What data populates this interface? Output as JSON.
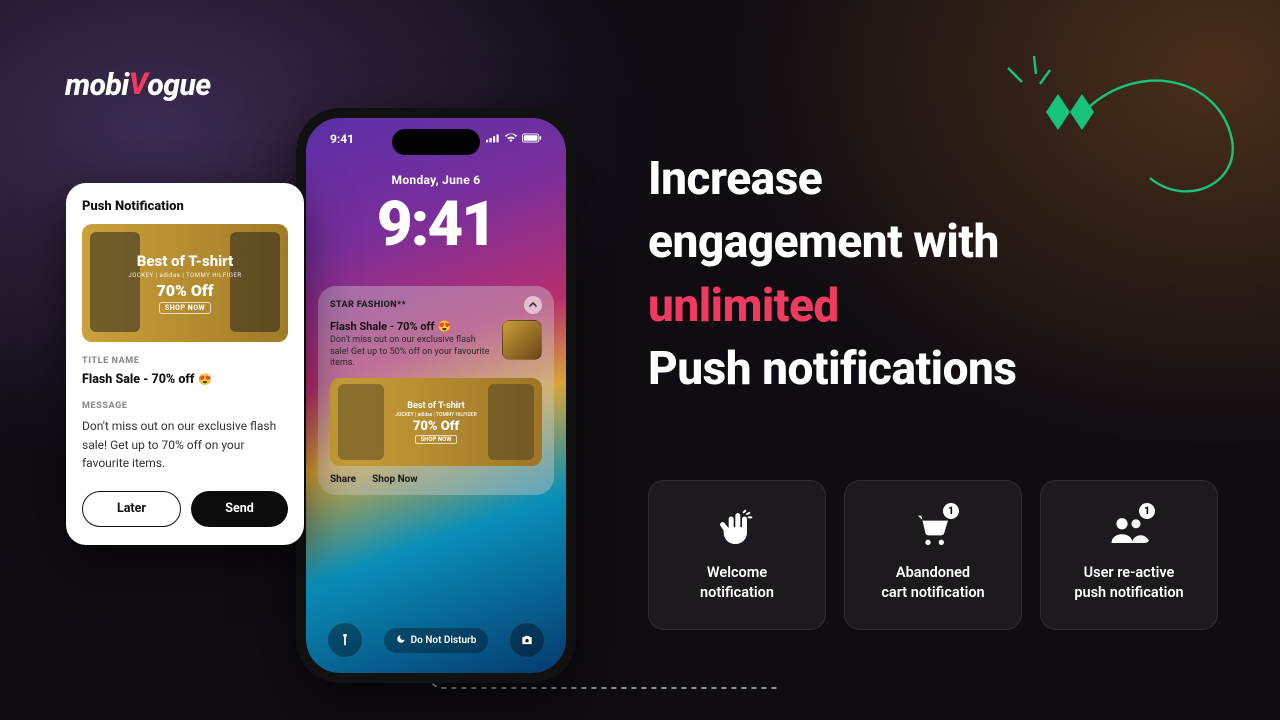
{
  "brand": {
    "pre": "mobi",
    "v": "V",
    "post": "ogue"
  },
  "headline": {
    "l1": "Increase",
    "l2": "engagement with",
    "accent": "unlimited",
    "l3": "Push notifications"
  },
  "features": [
    {
      "label": "Welcome\nnotification"
    },
    {
      "label": "Abandoned\ncart notification",
      "badge": "1"
    },
    {
      "label": "User re-active\npush notification",
      "badge": "1"
    }
  ],
  "phone": {
    "time_small": "9:41",
    "date": "Monday, June 6",
    "time_big": "9:41",
    "notif": {
      "app": "STAR FASHION**",
      "title": "Flash Shale - 70% off",
      "body": "Don't miss out on our exclusive flash sale! Get up to 50% off on your favourite items.",
      "banner_title": "Best of T-shirt",
      "banner_brands": "JOCKEY | adidas | TOMMY HILFIGER",
      "banner_off": "70% Off",
      "banner_cta": "SHOP NOW",
      "action_share": "Share",
      "action_shop": "Shop Now"
    },
    "dnd": "Do Not Disturb"
  },
  "card": {
    "header": "Push Notification",
    "banner_title": "Best of T-shirt",
    "banner_brands": "JOCKEY | adidas | TOMMY HILFIGER",
    "banner_off": "70% Off",
    "banner_cta": "SHOP NOW",
    "title_label": "TITLE NAME",
    "title_value": "Flash Sale - 70% off",
    "message_label": "MESSAGE",
    "message_value": "Don't miss out on our exclusive flash sale! Get up to 70% off on your favourite items.",
    "btn_later": "Later",
    "btn_send": "Send"
  }
}
